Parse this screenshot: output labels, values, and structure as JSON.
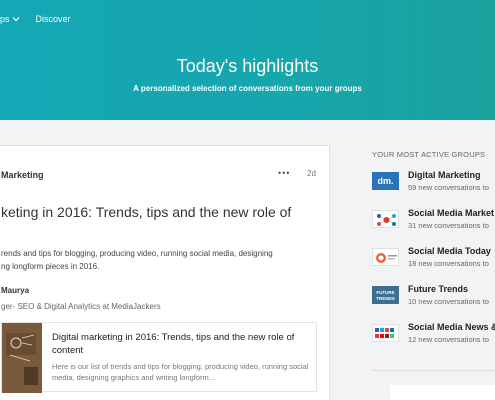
{
  "nav": {
    "items": [
      {
        "label": "ps",
        "has_dropdown": true
      },
      {
        "label": "Discover",
        "has_dropdown": false
      }
    ]
  },
  "hero": {
    "title": "Today's highlights",
    "subtitle": "A personalized selection of conversations from your groups"
  },
  "post": {
    "group": "Marketing",
    "menu": "•••",
    "time": "2d",
    "title": "keting in 2016: Trends, tips and the new role of",
    "excerpt_line1": "rends and tips for blogging, producing video, running social media, designing",
    "excerpt_line2": "ng longform pieces in 2016.",
    "author": "Maurya",
    "author_role": "ger- SEO & Digital Analytics at MediaJackers",
    "preview": {
      "title": "Digital marketing in 2016: Trends, tips and the new role of content",
      "description": "Here is our list of trends and tips for blogging, producing video, running social media, designing graphics and writing longform…"
    }
  },
  "sidebar": {
    "heading": "YOUR MOST ACTIVE GROUPS",
    "groups": [
      {
        "name": "Digital Marketing",
        "count": "59 new conversations to",
        "logo": "dm-logo",
        "logo_text": "dm."
      },
      {
        "name": "Social Media Market",
        "count": "31 new conversations to",
        "logo": "social-media-marketing-logo",
        "logo_text": ""
      },
      {
        "name": "Social Media Today",
        "count": "18 new conversations to",
        "logo": "social-media-today-logo",
        "logo_text": ""
      },
      {
        "name": "Future Trends",
        "count": "10 new conversations to",
        "logo": "future-trends-logo",
        "logo_text": "FUTURE TRENDS"
      },
      {
        "name": "Social Media News &",
        "count": "12 new conversations to",
        "logo": "social-media-news-logo",
        "logo_text": ""
      }
    ]
  },
  "colors": {
    "hero_start": "#15a7b6",
    "hero_end": "#1ba29e",
    "background": "#f2f3f5",
    "dm_logo": "#2b73b8"
  }
}
